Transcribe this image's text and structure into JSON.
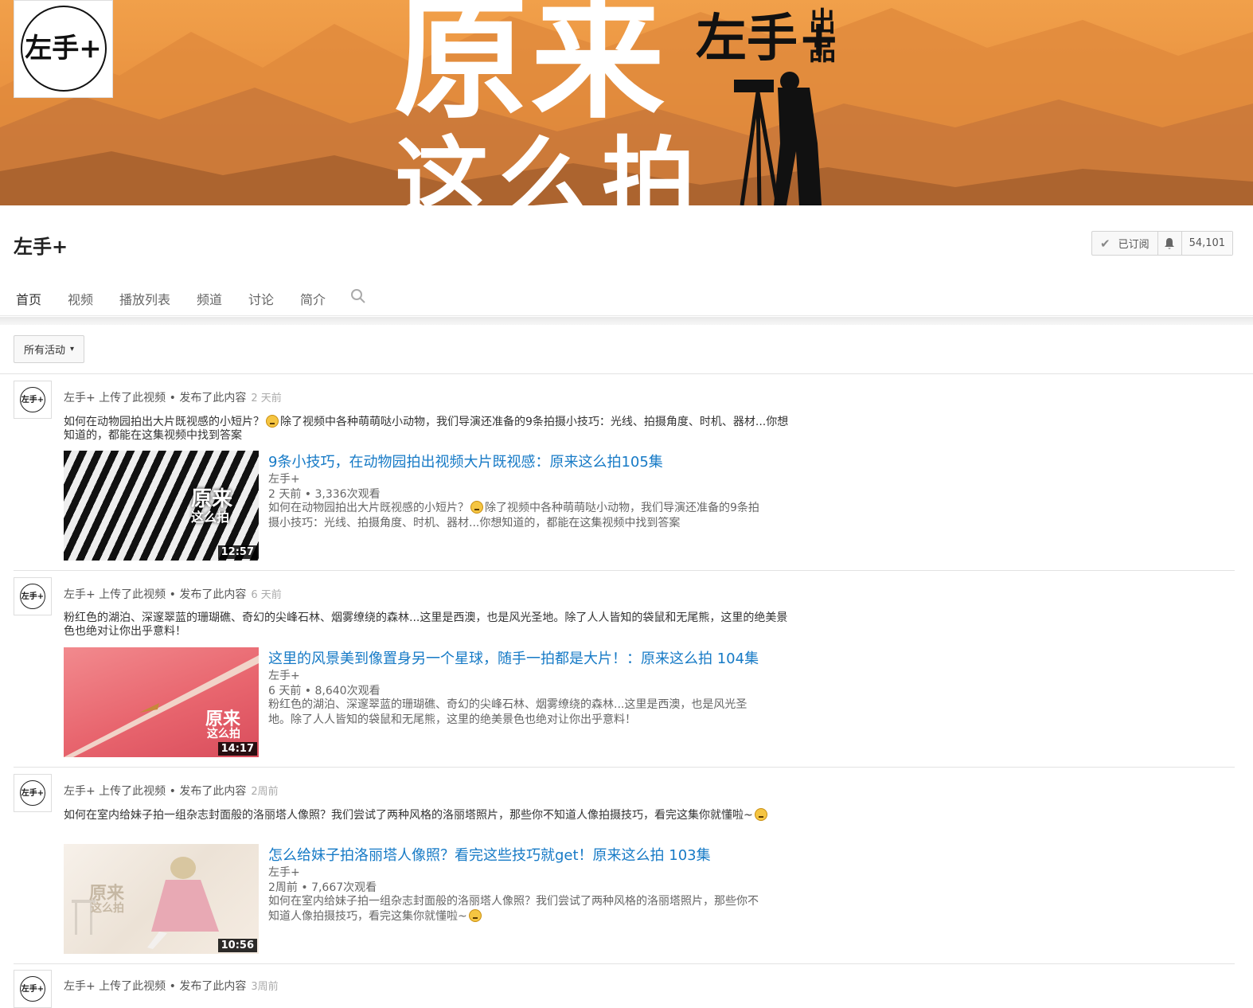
{
  "banner": {
    "title_line1": "原来",
    "title_line2": "这么拍",
    "brand": "左手+",
    "brand_tag": "出品",
    "logo_text": "左手+"
  },
  "channel": {
    "name": "左手+",
    "subscribe_label": "已订阅",
    "check_icon": "✔",
    "bell_icon": "bell-icon",
    "subscriber_count": "54,101"
  },
  "tabs": [
    "首页",
    "视频",
    "播放列表",
    "频道",
    "讨论",
    "简介"
  ],
  "filter": {
    "label": "所有活动",
    "caret": "▾"
  },
  "feed": [
    {
      "avatar_text": "左手+",
      "action": "左手+ 上传了此视频 • 发布了此内容",
      "ago": "2 天前",
      "post_text_1": "如何在动物园拍出大片既视感的小短片？",
      "post_text_2": "除了视频中各种萌萌哒小动物，我们导演还准备的9条拍摄小技巧：光线、拍摄角度、时机、器材...你想知道的，都能在这集视频中找到答案",
      "video_title": "9条小技巧，在动物园拍出视频大片既视感：原来这么拍105集",
      "owner": "左手+",
      "stats": "2 天前 • 3,336次观看",
      "video_desc_1": "如何在动物园拍出大片既视感的小短片？",
      "video_desc_2": "除了视频中各种萌萌哒小动物，我们导演还准备的9条拍摄小技巧：光线、拍摄角度、时机、器材...你想知道的，都能在这集视频中找到答案",
      "duration": "12:57",
      "thumb_text_1": "原来",
      "thumb_text_2": "这么拍"
    },
    {
      "avatar_text": "左手+",
      "action": "左手+ 上传了此视频 • 发布了此内容",
      "ago": "6 天前",
      "post_text": "粉红色的湖泊、深邃翠蓝的珊瑚礁、奇幻的尖峰石林、烟雾缭绕的森林...这里是西澳，也是风光圣地。除了人人皆知的袋鼠和无尾熊，这里的绝美景色也绝对让你出乎意料！",
      "video_title": "这里的风景美到像置身另一个星球，随手一拍都是大片！：原来这么拍 104集",
      "owner": "左手+",
      "stats": "6 天前 • 8,640次观看",
      "video_desc": "粉红色的湖泊、深邃翠蓝的珊瑚礁、奇幻的尖峰石林、烟雾缭绕的森林...这里是西澳，也是风光圣地。除了人人皆知的袋鼠和无尾熊，这里的绝美景色也绝对让你出乎意料！",
      "duration": "14:17",
      "thumb_text_1": "原来",
      "thumb_text_2": "这么拍"
    },
    {
      "avatar_text": "左手+",
      "action": "左手+ 上传了此视频 • 发布了此内容",
      "ago": "2周前",
      "post_text": "如何在室内给妹子拍一组杂志封面般的洛丽塔人像照？我们尝试了两种风格的洛丽塔照片，那些你不知道人像拍摄技巧，看完这集你就懂啦~",
      "video_title": "怎么给妹子拍洛丽塔人像照？看完这些技巧就get！原来这么拍 103集",
      "owner": "左手+",
      "stats": "2周前 • 7,667次观看",
      "video_desc": "如何在室内给妹子拍一组杂志封面般的洛丽塔人像照？我们尝试了两种风格的洛丽塔照片，那些你不知道人像拍摄技巧，看完这集你就懂啦~",
      "duration": "10:56",
      "thumb_text_1": "原来",
      "thumb_text_2": "这么拍"
    },
    {
      "avatar_text": "左手+",
      "action": "左手+ 上传了此视频 • 发布了此内容",
      "ago": "3周前"
    }
  ],
  "colors": {
    "link": "#167ac6",
    "banner_orange": "#e99240"
  }
}
